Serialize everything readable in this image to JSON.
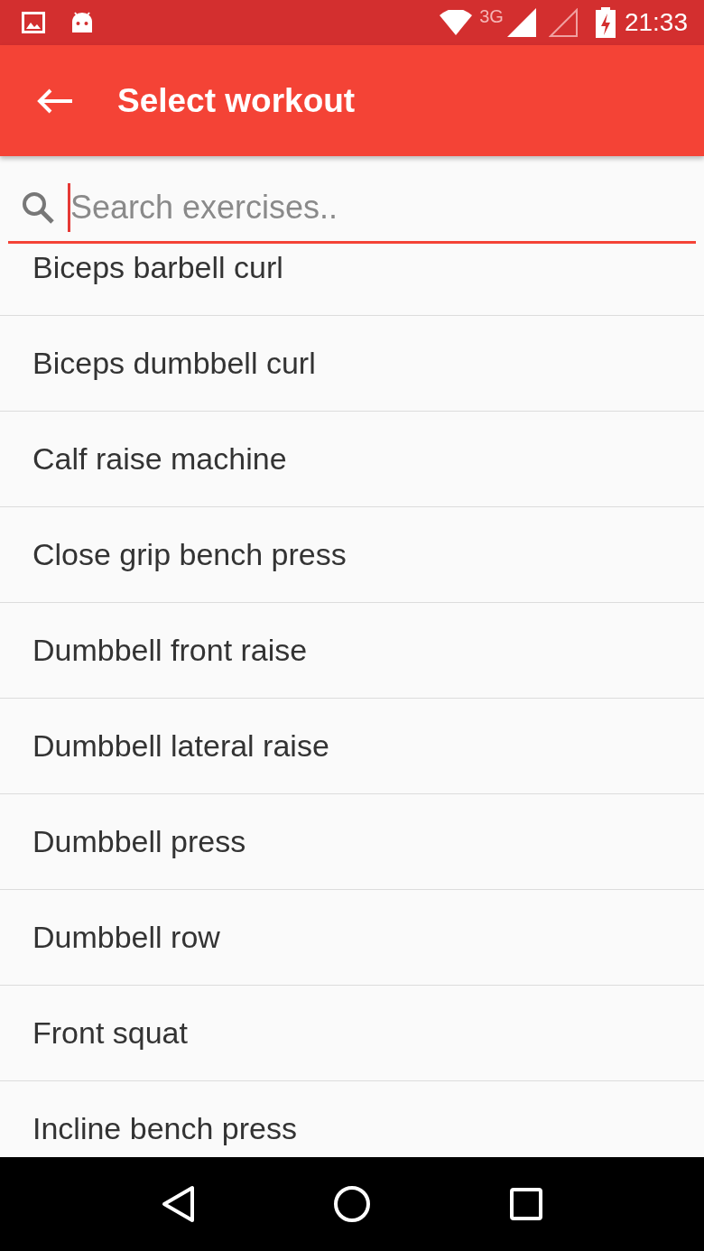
{
  "status_bar": {
    "network": "3G",
    "time": "21:33"
  },
  "toolbar": {
    "title": "Select workout"
  },
  "search": {
    "placeholder": "Search exercises.."
  },
  "exercises": [
    {
      "name": "Biceps barbell curl"
    },
    {
      "name": "Biceps dumbbell curl"
    },
    {
      "name": "Calf raise machine"
    },
    {
      "name": "Close grip bench press"
    },
    {
      "name": "Dumbbell front raise"
    },
    {
      "name": "Dumbbell lateral raise"
    },
    {
      "name": "Dumbbell press"
    },
    {
      "name": "Dumbbell row"
    },
    {
      "name": "Front squat"
    },
    {
      "name": "Incline bench press"
    }
  ]
}
